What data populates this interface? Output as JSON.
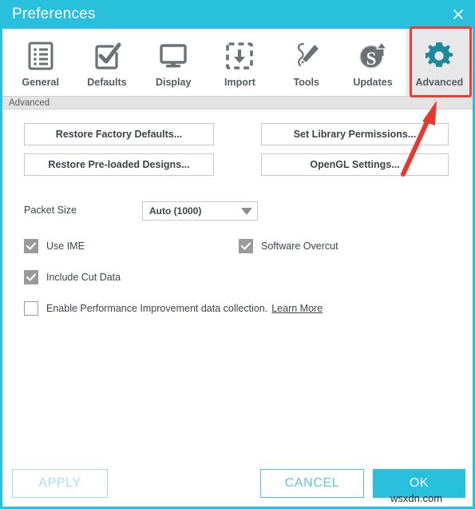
{
  "window": {
    "title": "Preferences",
    "close_icon": "close-icon",
    "accent_color": "#29c0de",
    "highlight_color": "#ee3b33"
  },
  "tabs": [
    {
      "label": "General",
      "icon": "list-document-icon",
      "selected": false
    },
    {
      "label": "Defaults",
      "icon": "checkbox-check-icon",
      "selected": false
    },
    {
      "label": "Display",
      "icon": "monitor-icon",
      "selected": false
    },
    {
      "label": "Import",
      "icon": "import-download-icon",
      "selected": false
    },
    {
      "label": "Tools",
      "icon": "pen-draw-icon",
      "selected": false
    },
    {
      "label": "Updates",
      "icon": "updates-s-arrow-icon",
      "selected": false
    },
    {
      "label": "Advanced",
      "icon": "gear-icon",
      "selected": true
    }
  ],
  "section": {
    "header_label": "Advanced"
  },
  "buttons": {
    "restore_factory": "Restore Factory Defaults...",
    "restore_preloaded": "Restore Pre-loaded Designs...",
    "set_library": "Set Library Permissions...",
    "opengl": "OpenGL Settings..."
  },
  "packet": {
    "label": "Packet Size",
    "value": "Auto (1000)",
    "arrow_icon": "chevron-down-icon",
    "options": [
      "Auto (1000)"
    ]
  },
  "checkboxes": [
    {
      "label": "Use IME",
      "checked": true
    },
    {
      "label": "Software Overcut",
      "checked": true
    },
    {
      "label": "Include Cut Data",
      "checked": true
    },
    {
      "label": "Enable Performance Improvement data collection.",
      "checked": false,
      "link": "Learn More"
    }
  ],
  "footer": {
    "apply": "APPLY",
    "apply_disabled": true,
    "cancel": "CANCEL",
    "ok": "OK"
  },
  "annotation": {
    "arrow_icon": "red-arrow-pointer",
    "color": "#e23a30"
  },
  "watermark": {
    "text": "wsxdn.com"
  }
}
